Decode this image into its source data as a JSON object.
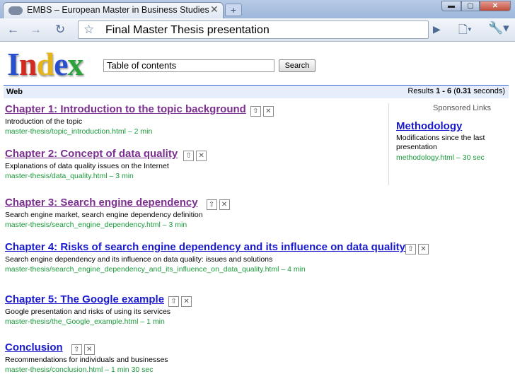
{
  "browser": {
    "tab_title": "EMBS – European Master in Business Studies",
    "tab_close": "✕",
    "new_tab": "+",
    "window_buttons": {
      "minimize": "▬",
      "maximize": "▢",
      "close": "✕"
    },
    "back_icon": "←",
    "forward_icon": "→",
    "reload_icon": "↻",
    "star_icon": "☆",
    "omnibox_text": "Final Master Thesis presentation",
    "go_icon": "▶",
    "page_menu_icon": "🗋▾",
    "tools_menu_icon": "🔧▾"
  },
  "logo": {
    "letters": [
      "I",
      "n",
      "d",
      "e",
      "x"
    ],
    "colors": [
      "#2a4fcc",
      "#d22a1f",
      "#e4b41c",
      "#2a4fcc",
      "#2ba33a"
    ]
  },
  "search": {
    "value": "Table of contents",
    "button": "Search"
  },
  "results_bar": {
    "label": "Web",
    "prefix": "Results ",
    "range": "1 - 6",
    "open": " (",
    "time": "0.31",
    "suffix": " seconds)"
  },
  "results": [
    {
      "title": "Chapter 1: Introduction to the topic background",
      "desc": "Introduction of the topic",
      "url": "master-thesis/topic_introduction.html – 2 min",
      "visited": true
    },
    {
      "title": "Chapter 2: Concept of data quality",
      "desc": "Explanations of data quality issues on the  Internet",
      "url": "master-thesis/data_quality.html – 3 min",
      "visited": true
    },
    {
      "title": "Chapter 3: Search engine dependency",
      "desc": "Search engine market, search engine dependency definition",
      "url": "master-thesis/search_engine_dependency.html – 3 min",
      "visited": true
    },
    {
      "title": "Chapter 4: Risks of search engine dependency and its influence on data quality",
      "desc": "Search engine dependency and its influence on data quality: issues and solutions",
      "url": "master-thesis/search_engine_dependency_and_its_influence_on_data_quality.html – 4 min",
      "visited": false
    },
    {
      "title": "Chapter 5: The Google example",
      "desc": "Google presentation and risks of using its services",
      "url": "master-thesis/the_Google_example.html – 1 min",
      "visited": false
    },
    {
      "title": "Conclusion",
      "desc": "Recommendations for individuals and businesses",
      "url": "master-thesis/conclusion.html – 1 min 30 sec",
      "visited": false
    }
  ],
  "result_icons": {
    "promote": "⇧",
    "remove": "✕"
  },
  "sponsored": {
    "label": "Sponsored Links",
    "title": "Methodology",
    "desc": "Modifications since the last presentation",
    "url": "methodology.html – 30 sec"
  }
}
